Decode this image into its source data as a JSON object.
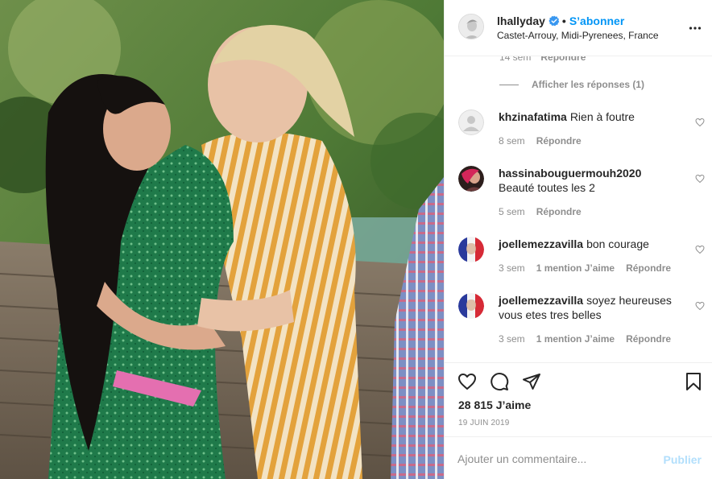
{
  "post": {
    "username": "lhallyday",
    "separator": "•",
    "follow_label": "S’abonner",
    "location": "Castet-Arrouy, Midi-Pyrenees, France"
  },
  "comments_top": {
    "time": "14 sem",
    "reply_label": "Répondre",
    "view_replies_label": "Afficher les réponses (1)"
  },
  "comments": [
    {
      "username": "khzinafatima",
      "text": "Rien à foutre",
      "time": "8 sem",
      "likes": "",
      "reply_label": "Répondre"
    },
    {
      "username": "hassinabouguermouh2020",
      "text": "Beauté toutes les 2",
      "time": "5 sem",
      "likes": "",
      "reply_label": "Répondre"
    },
    {
      "username": "joellemezzavilla",
      "text": "bon courage",
      "time": "3 sem",
      "likes": "1 mention J’aime",
      "reply_label": "Répondre"
    },
    {
      "username": "joellemezzavilla",
      "text": "soyez heureuses vous etes tres belles",
      "time": "3 sem",
      "likes": "1 mention J’aime",
      "reply_label": "Répondre"
    }
  ],
  "actions": {
    "likes_count": "28 815 J’aime",
    "date": "19 JUIN 2019"
  },
  "add_comment": {
    "placeholder": "Ajouter un commentaire...",
    "publish_label": "Publier"
  },
  "colors": {
    "accent_blue": "#0095f6",
    "publish_disabled": "#b2dffc",
    "muted_text": "#8e8e8e",
    "divider": "#efefef"
  },
  "icons": {
    "verified": "verified-badge-icon",
    "more": "more-options-icon",
    "heart": "heart-icon",
    "comment": "comment-icon",
    "share": "share-icon",
    "save": "bookmark-icon"
  }
}
